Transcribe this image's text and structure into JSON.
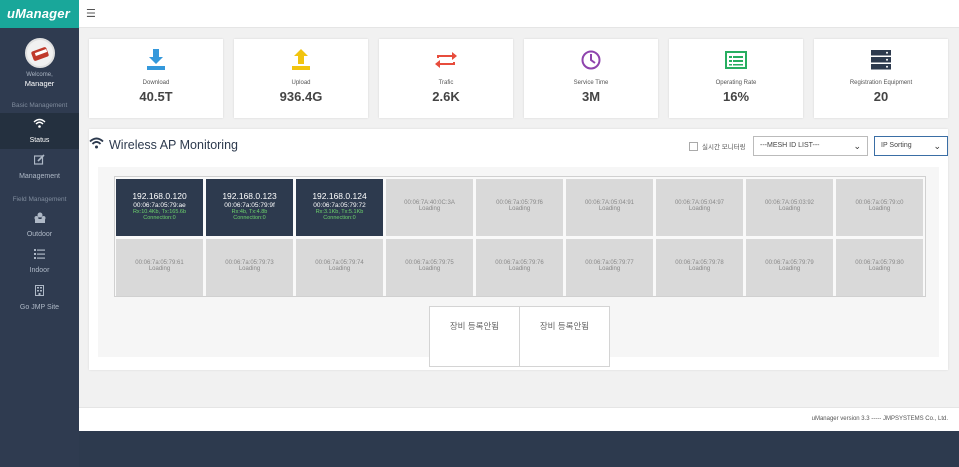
{
  "brand": "uManager",
  "profile": {
    "welcome": "Welcome,",
    "name": "Manager"
  },
  "sidebar": {
    "basic_title": "Basic Management",
    "field_title": "Field Management",
    "items": [
      {
        "label": "Status",
        "icon": "wifi-icon"
      },
      {
        "label": "Management",
        "icon": "edit-icon"
      },
      {
        "label": "Outdoor",
        "icon": "outdoor-icon"
      },
      {
        "label": "Indoor",
        "icon": "list-icon"
      },
      {
        "label": "Go JMP Site",
        "icon": "building-icon"
      }
    ]
  },
  "stats": [
    {
      "label": "Download",
      "value": "40.5T",
      "color": "#3498db",
      "icon": "download-icon"
    },
    {
      "label": "Upload",
      "value": "936.4G",
      "color": "#f1c40f",
      "icon": "upload-icon"
    },
    {
      "label": "Trafic",
      "value": "2.6K",
      "color": "#e74c3c",
      "icon": "traffic-icon"
    },
    {
      "label": "Service Time",
      "value": "3M",
      "color": "#8e44ad",
      "icon": "clock-icon"
    },
    {
      "label": "Operating Rate",
      "value": "16%",
      "color": "#27ae60",
      "icon": "rate-icon"
    },
    {
      "label": "Registration Equipment",
      "value": "20",
      "color": "#2d3a4e",
      "icon": "server-icon"
    }
  ],
  "monitor": {
    "title": "Wireless AP Monitoring",
    "realtime_label": "실시간 모니터링",
    "mesh_select": "---MESH ID LIST---",
    "sort_select": "IP Sorting"
  },
  "tiles": [
    {
      "active": true,
      "ip": "192.168.0.120",
      "mac": "00:06:7a:05:79:ae",
      "rx": "Rx:10.4Kb, Tx:165.6b",
      "conn": "Connection:0"
    },
    {
      "active": true,
      "ip": "192.168.0.123",
      "mac": "00:06:7a:05:79:9f",
      "rx": "Rx:4b, Tx:4.8b",
      "conn": "Connection:0"
    },
    {
      "active": true,
      "ip": "192.168.0.124",
      "mac": "00:06:7a:05:79:72",
      "rx": "Rx:3.1Kb, Tx:5.1Kb",
      "conn": "Connection:0"
    },
    {
      "active": false,
      "mac": "00:06:7A:40:0C:3A",
      "status": "Loading"
    },
    {
      "active": false,
      "mac": "00:06:7a:05:79:f6",
      "status": "Loading"
    },
    {
      "active": false,
      "mac": "00:06:7A:05:04:91",
      "status": "Loading"
    },
    {
      "active": false,
      "mac": "00:06:7A:05:04:97",
      "status": "Loading"
    },
    {
      "active": false,
      "mac": "00:06:7A:05:03:92",
      "status": "Loading"
    },
    {
      "active": false,
      "mac": "00:06:7a:05:79:c0",
      "status": "Loading"
    },
    {
      "active": false,
      "mac": "00:06:7a:05:79:61",
      "status": "Loading"
    },
    {
      "active": false,
      "mac": "00:06:7a:05:79:73",
      "status": "Loading"
    },
    {
      "active": false,
      "mac": "00:06:7a:05:79:74",
      "status": "Loading"
    },
    {
      "active": false,
      "mac": "00:06:7a:05:79:75",
      "status": "Loading"
    },
    {
      "active": false,
      "mac": "00:06:7a:05:79:76",
      "status": "Loading"
    },
    {
      "active": false,
      "mac": "00:06:7a:05:79:77",
      "status": "Loading"
    },
    {
      "active": false,
      "mac": "00:06:7a:05:79:78",
      "status": "Loading"
    },
    {
      "active": false,
      "mac": "00:06:7a:05:79:79",
      "status": "Loading"
    },
    {
      "active": false,
      "mac": "00:06:7a:05:79:80",
      "status": "Loading"
    }
  ],
  "unregistered": [
    "장비 등록안됨",
    "장비 등록안됨"
  ],
  "footer": "uManager version 3.3 ----- JMPSYSTEMS Co., Ltd."
}
